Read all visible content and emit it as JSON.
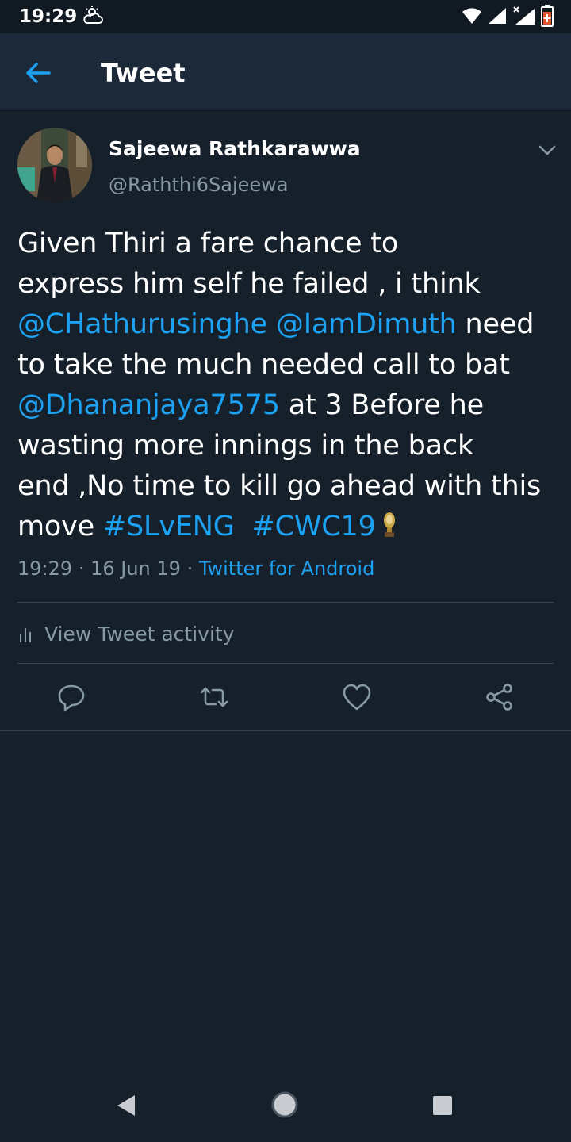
{
  "status_bar": {
    "time": "19:29"
  },
  "app_bar": {
    "title": "Tweet"
  },
  "tweet": {
    "author_name": "Sajeewa Rathkarawwa",
    "author_handle": "@Raththi6Sajeewa",
    "text_lines": {
      "l1": "Given Thiri a fare chance to",
      "l2": "express him self he failed , i think",
      "l3_mention1": "@CHathurusinghe",
      "l3_mention2": "@IamDimuth",
      "l3_rest": " need",
      "l4": "to take the much needed call to bat",
      "l5_mention": "@Dhananjaya7575",
      "l5_rest": " at 3 Before he",
      "l6": "wasting more innings in the back",
      "l7": "end ,No time to kill go ahead with this",
      "l8_prefix": "move ",
      "l8_tag1": "#SLvENG",
      "l8_tag2": "#CWC19"
    },
    "time": "19:29",
    "date": "16 Jun 19",
    "source": "Twitter for Android"
  },
  "activity": {
    "label": "View Tweet activity"
  },
  "colors": {
    "background": "#15202b",
    "app_bar": "#1c2938",
    "accent": "#1da1f2",
    "secondary_text": "#8899a6",
    "divider": "#38444d"
  },
  "icons": {
    "back": "arrow-left-icon",
    "caret": "chevron-down-icon",
    "reply": "reply-icon",
    "retweet": "retweet-icon",
    "like": "heart-icon",
    "share": "share-icon",
    "activity": "bar-chart-icon"
  }
}
